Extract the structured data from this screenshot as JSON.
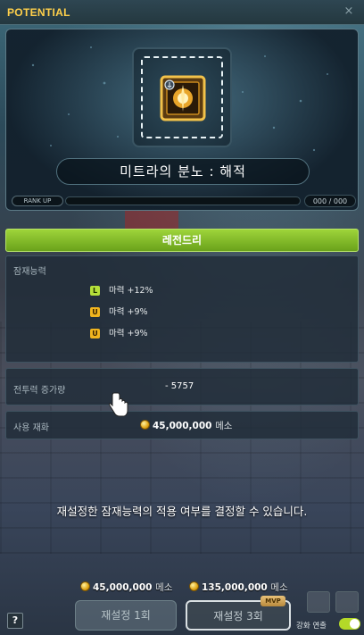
{
  "window": {
    "title": "POTENTIAL",
    "close_label": "×"
  },
  "item": {
    "name": "미트라의 분노 : 해적"
  },
  "rankup": {
    "label": "RANK UP",
    "count": "000 / 000"
  },
  "grade": {
    "label": "레전드리",
    "color": "#8cc42c"
  },
  "potential": {
    "header": "잠재능력",
    "lines": [
      {
        "badge": "L",
        "text": "마력 +12%"
      },
      {
        "badge": "U",
        "text": "마력 +9%"
      },
      {
        "badge": "U",
        "text": "마력 +9%"
      }
    ]
  },
  "combat_power": {
    "label": "전투력 증가량",
    "value": "- 5757"
  },
  "cost": {
    "label": "사용 재화",
    "amount": "45,000,000",
    "unit": "메소"
  },
  "message": "재설정한 잠재능력의 적용 여부를 결정할 수 있습니다.",
  "bottom": {
    "cost_1": {
      "amount": "45,000,000",
      "unit": "메소"
    },
    "cost_3": {
      "amount": "135,000,000",
      "unit": "메소"
    },
    "help_label": "?",
    "reset_1_label": "재설정 1회",
    "reset_3_label": "재설정 3회",
    "mvp_badge": "MVP",
    "auto_label": "강화 연출",
    "auto_on": true
  }
}
